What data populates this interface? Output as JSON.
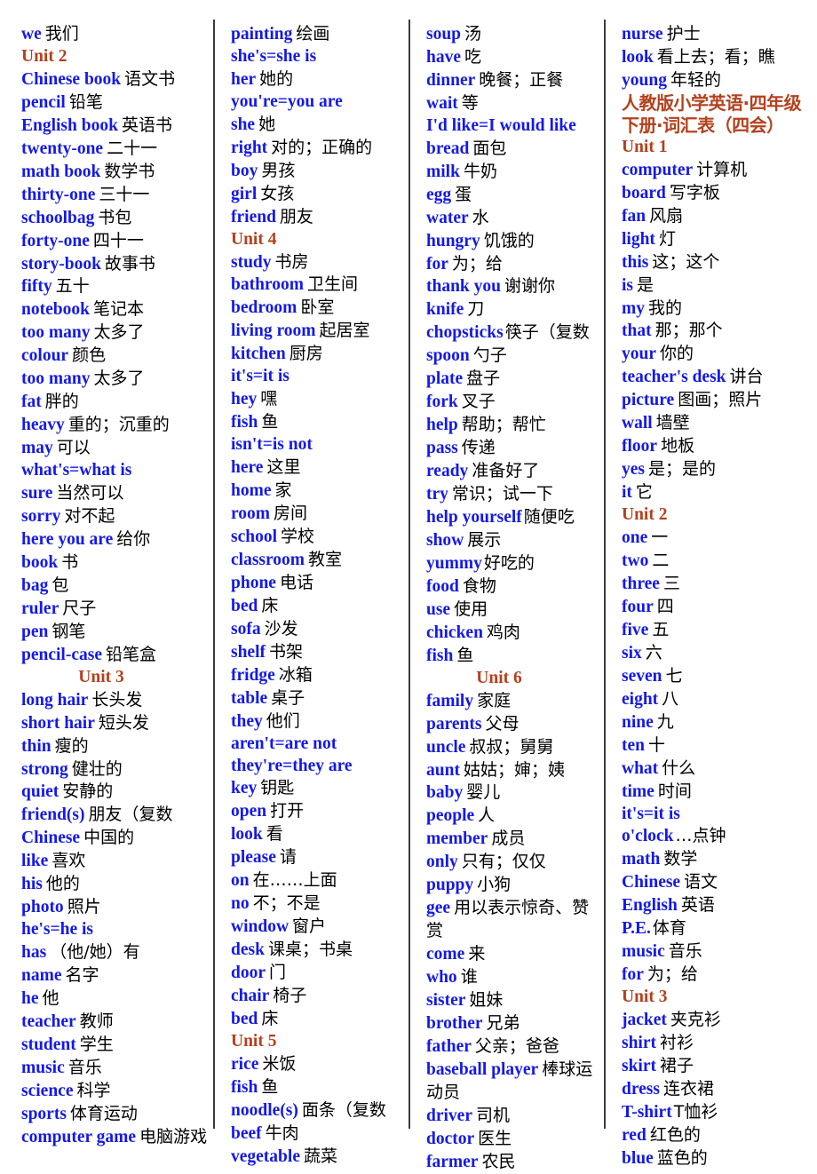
{
  "document": {
    "title": "人教版小学英语·四年级下册·词汇表（四会）",
    "accent_color": "#b4411e",
    "english_color": "#1419e8",
    "chinese_color": "#000000"
  },
  "columns": [
    {
      "id": "column-1",
      "entries": [
        {
          "en": "we",
          "cn": "我们"
        },
        {
          "unit": "Unit 2"
        },
        {
          "en": "Chinese book",
          "cn": "语文书"
        },
        {
          "en": "pencil",
          "cn": "铅笔"
        },
        {
          "en": "English book",
          "cn": "英语书"
        },
        {
          "en": "twenty-one",
          "cn": "二十一"
        },
        {
          "en": "math book",
          "cn": "数学书"
        },
        {
          "en": "thirty-one",
          "cn": "三十一"
        },
        {
          "en": "schoolbag",
          "cn": "书包"
        },
        {
          "en": "forty-one",
          "cn": "四十一"
        },
        {
          "en": "story-book",
          "cn": "故事书"
        },
        {
          "en": "fifty",
          "cn": "五十"
        },
        {
          "en": "notebook",
          "cn": "笔记本"
        },
        {
          "en": "too many",
          "cn": "太多了"
        },
        {
          "en": "colour",
          "cn": "颜色"
        },
        {
          "en": "too many",
          "cn": "太多了"
        },
        {
          "en": "fat",
          "cn": "胖的"
        },
        {
          "en": "heavy",
          "cn": "重的；沉重的"
        },
        {
          "en": "may",
          "cn": "可以"
        },
        {
          "en": "what's=what is",
          "cn": ""
        },
        {
          "en": "sure",
          "cn": "当然可以"
        },
        {
          "en": "sorry",
          "cn": "对不起"
        },
        {
          "en": "here you are",
          "cn": "给你"
        },
        {
          "en": "book",
          "cn": "书"
        },
        {
          "en": "bag",
          "cn": "包"
        },
        {
          "en": "ruler",
          "cn": "尺子"
        },
        {
          "en": "pen",
          "cn": "钢笔"
        },
        {
          "en": "pencil-case",
          "cn": "铅笔盒"
        },
        {
          "unit": "Unit 3",
          "centered": true
        },
        {
          "en": "long hair",
          "cn": "长头发"
        },
        {
          "en": "short hair",
          "cn": "短头发"
        },
        {
          "en": "thin",
          "cn": "瘦的"
        },
        {
          "en": "strong",
          "cn": "健壮的"
        },
        {
          "en": "quiet",
          "cn": "安静的"
        },
        {
          "en": "friend(s)",
          "cn": "朋友（复数"
        },
        {
          "en": "Chinese",
          "cn": "中国的"
        },
        {
          "en": "like",
          "cn": "喜欢"
        },
        {
          "en": "his",
          "cn": "他的"
        },
        {
          "en": "photo",
          "cn": "照片"
        },
        {
          "en": "he's=he is",
          "cn": ""
        },
        {
          "en": "has",
          "cn": "（他/她）有"
        },
        {
          "en": "name",
          "cn": "名字"
        },
        {
          "en": "he",
          "cn": "他"
        },
        {
          "en": "teacher",
          "cn": "教师"
        },
        {
          "en": "student",
          "cn": "学生"
        },
        {
          "en": "music",
          "cn": "音乐"
        },
        {
          "en": "science",
          "cn": "科学"
        },
        {
          "en": "sports",
          "cn": "体育运动"
        },
        {
          "en": "computer game",
          "cn": "电脑游戏"
        }
      ]
    },
    {
      "id": "column-2",
      "entries": [
        {
          "en": "painting",
          "cn": "绘画"
        },
        {
          "en": "she's=she is",
          "cn": ""
        },
        {
          "en": "her",
          "cn": "她的"
        },
        {
          "en": "you're=you are",
          "cn": ""
        },
        {
          "en": "she",
          "cn": "她"
        },
        {
          "en": "right",
          "cn": "对的；正确的"
        },
        {
          "en": "boy",
          "cn": "男孩"
        },
        {
          "en": "girl",
          "cn": "女孩"
        },
        {
          "en": "friend",
          "cn": "朋友"
        },
        {
          "unit": "Unit 4"
        },
        {
          "en": "study",
          "cn": "书房"
        },
        {
          "en": "bathroom",
          "cn": "卫生间"
        },
        {
          "en": "bedroom",
          "cn": "卧室"
        },
        {
          "en": "living room",
          "cn": "起居室"
        },
        {
          "en": "kitchen",
          "cn": "厨房"
        },
        {
          "en": "it's=it is",
          "cn": ""
        },
        {
          "en": "hey",
          "cn": "嘿"
        },
        {
          "en": "fish",
          "cn": "鱼"
        },
        {
          "en": "isn't=is not",
          "cn": ""
        },
        {
          "en": "here",
          "cn": "这里"
        },
        {
          "en": "home",
          "cn": "家"
        },
        {
          "en": "room",
          "cn": "房间"
        },
        {
          "en": "school",
          "cn": "学校"
        },
        {
          "en": "classroom",
          "cn": "教室"
        },
        {
          "en": "phone",
          "cn": "电话"
        },
        {
          "en": "bed",
          "cn": "床"
        },
        {
          "en": "sofa",
          "cn": "沙发"
        },
        {
          "en": "shelf",
          "cn": "书架"
        },
        {
          "en": "fridge",
          "cn": "冰箱"
        },
        {
          "en": "table",
          "cn": "桌子"
        },
        {
          "en": "they",
          "cn": "他们"
        },
        {
          "en": "aren't=are not",
          "cn": ""
        },
        {
          "en": "they're=they are",
          "cn": ""
        },
        {
          "en": "key",
          "cn": "钥匙"
        },
        {
          "en": "open",
          "cn": "打开"
        },
        {
          "en": "look",
          "cn": "看"
        },
        {
          "en": "please",
          "cn": "请"
        },
        {
          "en": "on",
          "cn": "在……上面"
        },
        {
          "en": "no",
          "cn": "不；不是"
        },
        {
          "en": "window",
          "cn": "窗户"
        },
        {
          "en": "desk",
          "cn": "课桌；书桌"
        },
        {
          "en": "door",
          "cn": "门"
        },
        {
          "en": "chair",
          "cn": "椅子"
        },
        {
          "en": "bed",
          "cn": "床"
        },
        {
          "unit": "Unit 5"
        },
        {
          "en": "rice",
          "cn": "米饭"
        },
        {
          "en": "fish",
          "cn": "鱼"
        },
        {
          "en": "noodle(s)",
          "cn": "面条（复数"
        },
        {
          "en": "beef",
          "cn": "牛肉"
        },
        {
          "en": "vegetable",
          "cn": "蔬菜"
        }
      ]
    },
    {
      "id": "column-3",
      "entries": [
        {
          "en": "soup",
          "cn": "汤"
        },
        {
          "en": "have",
          "cn": "吃"
        },
        {
          "en": "dinner",
          "cn": "晚餐；正餐"
        },
        {
          "en": "wait",
          "cn": "等"
        },
        {
          "en": "I'd like=I would like",
          "cn": ""
        },
        {
          "en": "bread",
          "cn": "面包"
        },
        {
          "en": "milk",
          "cn": "牛奶"
        },
        {
          "en": "egg",
          "cn": "蛋"
        },
        {
          "en": "water",
          "cn": "水"
        },
        {
          "en": "hungry",
          "cn": "饥饿的"
        },
        {
          "en": "for",
          "cn": "为；给"
        },
        {
          "en": "thank you",
          "cn": "谢谢你"
        },
        {
          "en": "knife",
          "cn": "刀"
        },
        {
          "en": "chopsticks",
          "cn": "筷子（复数",
          "nogap": true
        },
        {
          "en": "spoon",
          "cn": "勺子"
        },
        {
          "en": "plate",
          "cn": "盘子"
        },
        {
          "en": "fork",
          "cn": "叉子"
        },
        {
          "en": "help",
          "cn": "帮助；帮忙"
        },
        {
          "en": "pass",
          "cn": "传递"
        },
        {
          "en": "ready",
          "cn": "准备好了"
        },
        {
          "en": "try",
          "cn": "常识；试一下"
        },
        {
          "en": "help yourself",
          "cn": "随便吃",
          "nogap": true
        },
        {
          "en": "show",
          "cn": "展示"
        },
        {
          "en": "yummy",
          "cn": "好吃的",
          "nogap": true
        },
        {
          "en": "food",
          "cn": "食物"
        },
        {
          "en": "use",
          "cn": "使用"
        },
        {
          "en": "chicken",
          "cn": "鸡肉"
        },
        {
          "en": "fish",
          "cn": "鱼"
        },
        {
          "unit": "Unit 6",
          "centered": true
        },
        {
          "en": "family",
          "cn": "家庭"
        },
        {
          "en": "parents",
          "cn": "父母"
        },
        {
          "en": "uncle",
          "cn": "叔叔；舅舅"
        },
        {
          "en": "aunt",
          "cn": "姑姑；婶；姨"
        },
        {
          "en": "baby",
          "cn": "婴儿"
        },
        {
          "en": "people",
          "cn": "人"
        },
        {
          "en": "member",
          "cn": "成员"
        },
        {
          "en": "only",
          "cn": "只有；仅仅"
        },
        {
          "en": "puppy",
          "cn": "小狗"
        },
        {
          "en": "gee",
          "cn": "用以表示惊奇、赞赏"
        },
        {
          "en": "come",
          "cn": "来"
        },
        {
          "en": "who",
          "cn": "谁"
        },
        {
          "en": "sister",
          "cn": "姐妹"
        },
        {
          "en": "brother",
          "cn": "兄弟"
        },
        {
          "en": "father",
          "cn": "父亲；爸爸"
        },
        {
          "en": "baseball player",
          "cn": "棒球运动员"
        },
        {
          "en": "driver",
          "cn": "司机"
        },
        {
          "en": "doctor",
          "cn": "医生"
        },
        {
          "en": "farmer",
          "cn": "农民"
        }
      ]
    },
    {
      "id": "column-4",
      "entries": [
        {
          "en": "nurse",
          "cn": "护士"
        },
        {
          "en": "look",
          "cn": "看上去；看；瞧"
        },
        {
          "en": "young",
          "cn": "年轻的"
        },
        {
          "doc_title": "人教版小学英语·四年级下册·词汇表（四会）"
        },
        {
          "unit": "Unit 1"
        },
        {
          "en": "computer",
          "cn": "计算机"
        },
        {
          "en": "board",
          "cn": "写字板"
        },
        {
          "en": "fan",
          "cn": "风扇"
        },
        {
          "en": "light",
          "cn": "灯"
        },
        {
          "en": "this",
          "cn": "这；这个"
        },
        {
          "en": "is",
          "cn": "是"
        },
        {
          "en": "my",
          "cn": "我的"
        },
        {
          "en": "that",
          "cn": "那；那个"
        },
        {
          "en": "your",
          "cn": "你的"
        },
        {
          "en": "teacher's desk",
          "cn": "讲台"
        },
        {
          "en": "picture",
          "cn": "图画；照片"
        },
        {
          "en": "wall",
          "cn": "墙壁"
        },
        {
          "en": "floor",
          "cn": "地板"
        },
        {
          "en": "yes",
          "cn": "是；是的"
        },
        {
          "en": "it",
          "cn": "它"
        },
        {
          "unit": "Unit 2"
        },
        {
          "en": "one",
          "cn": "一"
        },
        {
          "en": "two",
          "cn": "二"
        },
        {
          "en": "three",
          "cn": "三"
        },
        {
          "en": "four",
          "cn": "四"
        },
        {
          "en": "five",
          "cn": "五"
        },
        {
          "en": "six",
          "cn": "六"
        },
        {
          "en": "seven",
          "cn": "七"
        },
        {
          "en": "eight",
          "cn": "八"
        },
        {
          "en": "nine",
          "cn": "九"
        },
        {
          "en": "ten",
          "cn": "十"
        },
        {
          "en": "what",
          "cn": "什么"
        },
        {
          "en": "time",
          "cn": "时间"
        },
        {
          "en": "it's=it is",
          "cn": ""
        },
        {
          "en": "o'clock",
          "cn": "…点钟",
          "nogap": true
        },
        {
          "en": "math",
          "cn": "数学"
        },
        {
          "en": "Chinese",
          "cn": "语文"
        },
        {
          "en": "English",
          "cn": "英语"
        },
        {
          "en": "P.E.",
          "cn": "体育",
          "nogap": true
        },
        {
          "en": "music",
          "cn": "音乐"
        },
        {
          "en": "for",
          "cn": "为；给"
        },
        {
          "unit": "Unit 3"
        },
        {
          "en": "jacket",
          "cn": "夹克衫"
        },
        {
          "en": "shirt",
          "cn": "衬衫"
        },
        {
          "en": "skirt",
          "cn": "裙子"
        },
        {
          "en": "dress",
          "cn": "连衣裙"
        },
        {
          "en": "T-shirt",
          "cn": "T恤衫",
          "nogap": true
        },
        {
          "en": "red",
          "cn": "红色的"
        },
        {
          "en": "blue",
          "cn": "蓝色的"
        }
      ]
    }
  ]
}
